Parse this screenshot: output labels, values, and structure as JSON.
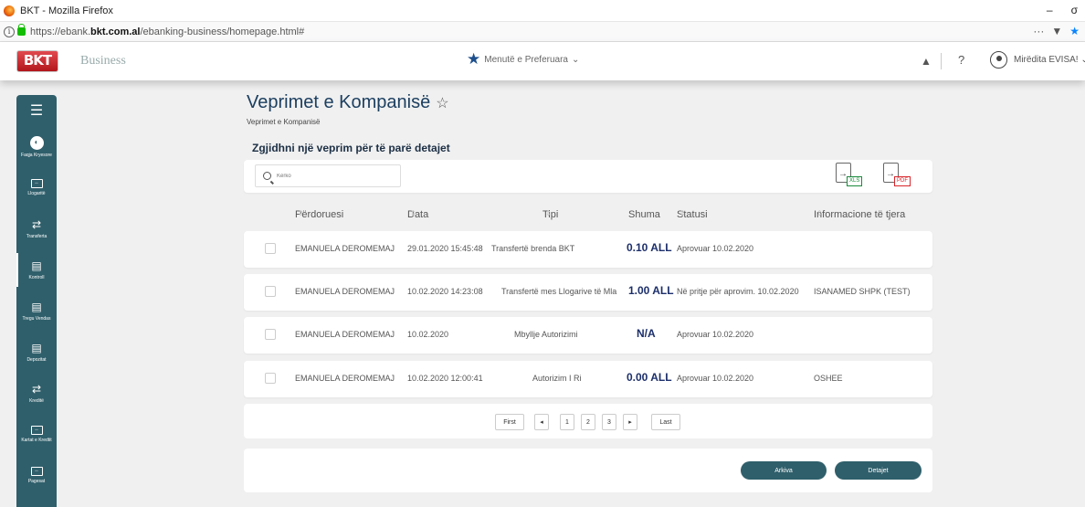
{
  "browser": {
    "window_title": "BKT - Mozilla Firefox",
    "window_controls": [
      "–",
      "σ"
    ],
    "url_prefix": "https://ebank.",
    "url_domain": "bkt.com.al",
    "url_path": "/ebanking-business/homepage.html#",
    "tools": [
      "···",
      "▼",
      "★"
    ]
  },
  "header": {
    "logo_text": "BKT",
    "app_name": "Business",
    "favorites_label": "Menutë e Preferuara",
    "help_label": "?",
    "user_greeting": "Mirëdita EVISA!"
  },
  "sidebar": {
    "items": [
      {
        "label": "Faqja Kryesore",
        "icon": "home-icon"
      },
      {
        "label": "Llogaritë",
        "icon": "card-icon"
      },
      {
        "label": "Transferta",
        "icon": "transfer-icon"
      },
      {
        "label": "Kontroll",
        "icon": "control-icon"
      },
      {
        "label": "Tregu Vendas",
        "icon": "market-icon"
      },
      {
        "label": "Depozitat",
        "icon": "deposit-icon"
      },
      {
        "label": "Kreditë",
        "icon": "credit-icon"
      },
      {
        "label": "Kartat e Kredtit",
        "icon": "credit-card-icon"
      },
      {
        "label": "Pagesat",
        "icon": "payment-icon"
      }
    ]
  },
  "page": {
    "title": "Veprimet e Kompanisë",
    "breadcrumb": "Veprimet e Kompanisë",
    "section_title": "Zgjidhni një veprim për të parë detajet",
    "search_placeholder": "Kërko",
    "export_xls": "XLS",
    "export_pdf": "PDF"
  },
  "table": {
    "columns": [
      "Përdoruesi",
      "Data",
      "Tipi",
      "Shuma",
      "Statusi",
      "Informacione të tjera"
    ],
    "rows": [
      {
        "user": "EMANUELA DEROMEMAJ",
        "date": "29.01.2020 15:45:48",
        "type": "Transfertë brenda BKT",
        "amount": "0.10 ALL",
        "status": "Aprovuar 10.02.2020",
        "info": ""
      },
      {
        "user": "EMANUELA DEROMEMAJ",
        "date": "10.02.2020 14:23:08",
        "type": "Transfertë mes Llogarive të Mla",
        "amount": "1.00 ALL",
        "status": "Në pritje për aprovim. 10.02.2020",
        "info": "ISANAMED SHPK (TEST)"
      },
      {
        "user": "EMANUELA DEROMEMAJ",
        "date": "10.02.2020",
        "type": "Mbyllje Autorizimi",
        "amount": "N/A",
        "status": "Aprovuar 10.02.2020",
        "info": ""
      },
      {
        "user": "EMANUELA DEROMEMAJ",
        "date": "10.02.2020 12:00:41",
        "type": "Autorizim I Ri",
        "amount": "0.00 ALL",
        "status": "Aprovuar 10.02.2020",
        "info": "OSHEE"
      }
    ]
  },
  "pagination": {
    "first": "First",
    "prev": "◂",
    "pages": [
      "1",
      "2",
      "3"
    ],
    "next": "▸",
    "last": "Last"
  },
  "actions": {
    "archive": "Arkiva",
    "details": "Detajet"
  },
  "colors": {
    "primary": "#2f5f6b",
    "title": "#1c3f60",
    "amount": "#1c2f6b",
    "background": "#f0f0f0"
  }
}
